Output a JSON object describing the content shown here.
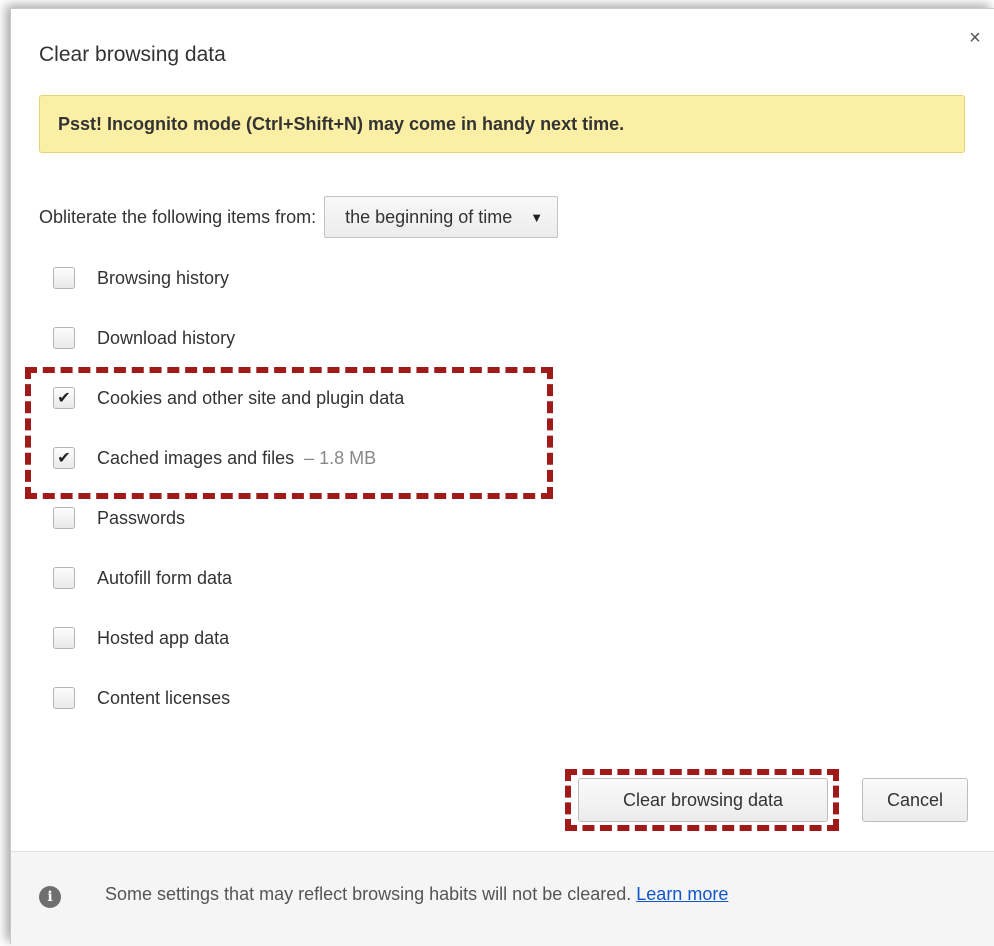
{
  "dialog": {
    "title": "Clear browsing data",
    "close_icon": "close-icon"
  },
  "banner": {
    "text": "Psst! Incognito mode (Ctrl+Shift+N) may come in handy next time."
  },
  "time_range": {
    "label": "Obliterate the following items from:",
    "selected": "the beginning of time",
    "caret": "▼"
  },
  "items": [
    {
      "label": "Browsing history",
      "checked": false
    },
    {
      "label": "Download history",
      "checked": false
    },
    {
      "label": "Cookies and other site and plugin data",
      "checked": true
    },
    {
      "label": "Cached images and files",
      "checked": true,
      "size": "–  1.8 MB"
    },
    {
      "label": "Passwords",
      "checked": false
    },
    {
      "label": "Autofill form data",
      "checked": false
    },
    {
      "label": "Hosted app data",
      "checked": false
    },
    {
      "label": "Content licenses",
      "checked": false
    }
  ],
  "buttons": {
    "clear": "Clear browsing data",
    "cancel": "Cancel"
  },
  "footer": {
    "text": "Some settings that may reflect browsing habits will not be cleared.",
    "link": "Learn more",
    "icon": "info-icon"
  },
  "colors": {
    "highlight": "#a01a1a",
    "banner_bg": "#fbeea5",
    "link": "#1155cc"
  }
}
